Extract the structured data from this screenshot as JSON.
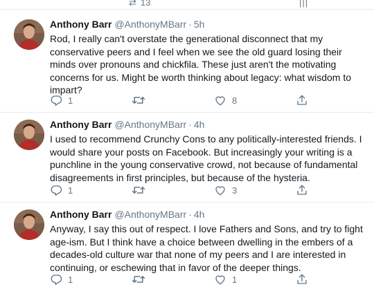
{
  "top_remnant": {
    "retweet_count": "13"
  },
  "tweets": [
    {
      "author_name": "Anthony Barr",
      "handle": "@AnthonyMBarr",
      "separator": "·",
      "time": "5h",
      "lines": [
        "Rod, I really can't overstate the generational disconnect that my",
        "conservative peers and I feel when we see the old guard losing their",
        "minds over pronouns and chickfila. These just aren't the motivating",
        "concerns for us. Might be worth thinking about legacy: what wisdom to",
        "impart?"
      ],
      "reply_count": "1",
      "retweet_count": "",
      "like_count": "8"
    },
    {
      "author_name": "Anthony Barr",
      "handle": "@AnthonyMBarr",
      "separator": "·",
      "time": "4h",
      "lines": [
        "I used to recommend Crunchy Cons to any politically-interested friends. I",
        "would share your posts on Facebook. But increasingly your writing is a",
        "punchline in the young conservative crowd, not because of fundamental",
        "disagreements in first principles, but because of the hysteria."
      ],
      "reply_count": "1",
      "retweet_count": "",
      "like_count": "3"
    },
    {
      "author_name": "Anthony Barr",
      "handle": "@AnthonyMBarr",
      "separator": "·",
      "time": "4h",
      "lines": [
        "Anyway, I say this out of respect. I love Fathers and Sons, and try to fight",
        "age-ism. But I think have a choice between dwelling in the embers of a",
        "decades-old culture war that none of my peers and I are interested in",
        "continuing, or eschewing that in favor of the deeper things."
      ],
      "reply_count": "1",
      "retweet_count": "",
      "like_count": "1"
    }
  ],
  "colors": {
    "text_primary": "#14171a",
    "text_secondary": "#657786",
    "divider": "#e6ecf0"
  },
  "icons": {
    "reply": "reply-icon",
    "retweet": "retweet-icon",
    "like": "heart-icon",
    "share": "share-icon"
  }
}
